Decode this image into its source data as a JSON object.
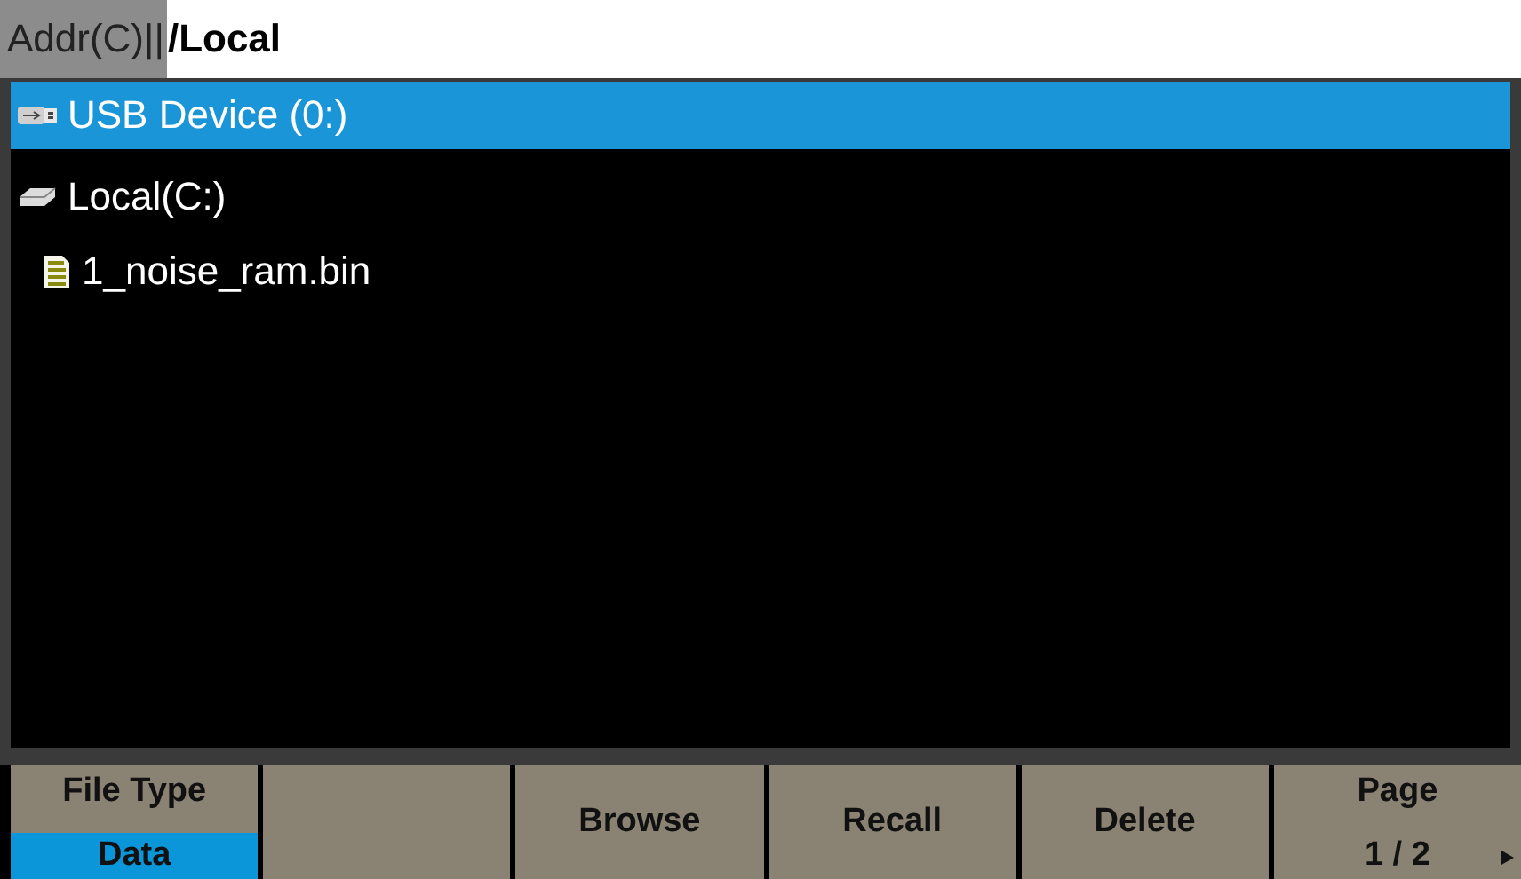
{
  "address_bar": {
    "label": "Addr(C)||",
    "path": "/Local"
  },
  "tree": [
    {
      "kind": "usb",
      "name": "USB Device (0:)",
      "selected": true
    },
    {
      "kind": "drive",
      "name": "Local(C:)",
      "selected": false,
      "children": [
        {
          "kind": "file",
          "name": "1_noise_ram.bin",
          "selected": false
        }
      ]
    }
  ],
  "softkeys": [
    {
      "kind": "option",
      "label": "File Type",
      "value": "Data"
    },
    {
      "kind": "blank"
    },
    {
      "kind": "action",
      "label": "Browse"
    },
    {
      "kind": "action",
      "label": "Recall"
    },
    {
      "kind": "action",
      "label": "Delete"
    },
    {
      "kind": "page",
      "label": "Page",
      "value": "1 / 2"
    }
  ]
}
